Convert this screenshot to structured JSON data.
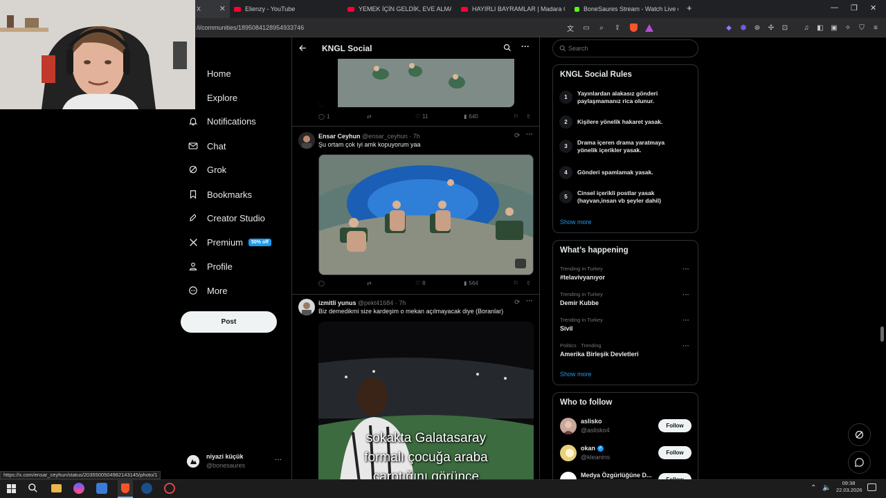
{
  "browser": {
    "tabs": [
      {
        "label": "X",
        "color": "#ffffff"
      },
      {
        "label": "Elienzy - YouTube",
        "color": "#ff0033"
      },
      {
        "label": "YEMEK İÇİN GELDİK, EVE ALMADILAR",
        "color": "#ff0033"
      },
      {
        "label": "HAYIRLI BAYRAMLAR | Madara Oldu!",
        "color": "#ff0033"
      },
      {
        "label": "BoneSaures Stream - Watch Live on",
        "color": "#53fc18"
      }
    ],
    "url": "/i/communities/1895084128954933746",
    "status_url": "https://x.com/ensar_ceyhun/status/2035500504982143145/photo/1"
  },
  "nav": {
    "items": [
      "Home",
      "Explore",
      "Notifications",
      "Chat",
      "Grok",
      "Bookmarks",
      "Creator Studio",
      "Premium",
      "Profile",
      "More"
    ],
    "premium_badge": "50% off",
    "post_label": "Post",
    "account_name": "niyazi küçük",
    "account_handle": "@bonesaures"
  },
  "header": {
    "title": "KNGL Social"
  },
  "posts": [
    {
      "stats": {
        "replies": "1",
        "reposts": "",
        "likes": "11",
        "views": "640"
      }
    },
    {
      "author": "Ensar Ceyhun",
      "handle": "@ensar_ceyhun",
      "time": "· 7h",
      "text": "Şu ortam çok iyi amk kopuyorum yaa",
      "stats": {
        "replies": "",
        "reposts": "",
        "likes": "8",
        "views": "564"
      }
    },
    {
      "author": "izmitli yunus",
      "handle": "@pekt41684",
      "time": "· 7h",
      "text": "Biz demedikmi size kardeşim o mekan açılmayacak diye (Boranlar)",
      "caption": [
        "sokakta Galatasaray",
        "formalı çocuğa araba",
        "çarptığını görünce"
      ]
    }
  ],
  "search": {
    "placeholder": "Search"
  },
  "rules": {
    "title": "KNGL Social Rules",
    "items": [
      {
        "n": "1",
        "lines": [
          "Yayınlardan alakasız gönderi",
          "paylaşmamanız rica olunur."
        ]
      },
      {
        "n": "2",
        "lines": [
          "Kişilere yönelik hakaret yasak.",
          ""
        ]
      },
      {
        "n": "3",
        "lines": [
          "Drama içeren drama yaratmaya",
          "yönelik içerikler yasak."
        ]
      },
      {
        "n": "4",
        "lines": [
          "Gönderi spamlamak yasak.",
          ""
        ]
      },
      {
        "n": "5",
        "lines": [
          "Cinsel içerikli postlar yasak",
          "(hayvan,insan vb şeyler dahil)"
        ]
      }
    ],
    "show_more": "Show more"
  },
  "trends": {
    "title": "What’s happening",
    "items": [
      {
        "context": "Trending in Turkey",
        "name": "#telavivyanıyor"
      },
      {
        "context": "Trending in Turkey",
        "name": "Demir Kubbe"
      },
      {
        "context": "Trending in Turkey",
        "name": "Sivil"
      },
      {
        "context": "Politics · Trending",
        "name": "Amerika Birleşik Devletleri"
      }
    ],
    "show_more": "Show more"
  },
  "who_to_follow": {
    "title": "Who to follow",
    "follow_label": "Follow",
    "items": [
      {
        "name": "aslisko",
        "handle": "@aslisko4"
      },
      {
        "name": "okan",
        "handle": "@kleanins"
      },
      {
        "name": "Medya Özgürlüğüne D...",
        "handle": ""
      }
    ]
  },
  "taskbar": {
    "time": "09:38",
    "date": "22.03.2026"
  },
  "colors": {
    "accent": "#1d9bf0",
    "background": "#000000",
    "border": "#2f3336",
    "muted": "#71767b"
  }
}
